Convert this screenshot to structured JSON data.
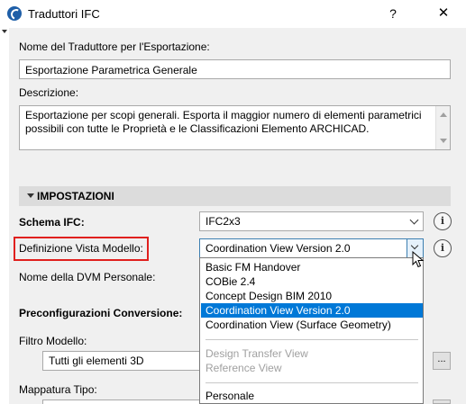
{
  "window": {
    "title": "Traduttori IFC",
    "help_label": "?",
    "close_label": "✕"
  },
  "export_name": {
    "label": "Nome del Traduttore per l'Esportazione:",
    "value": "Esportazione Parametrica Generale"
  },
  "description": {
    "label": "Descrizione:",
    "value": "Esportazione per scopi generali. Esporta il maggior numero di elementi parametrici possibili con tutte le Proprietà e le Classificazioni Elemento ARCHICAD."
  },
  "settings": {
    "header": "IMPOSTAZIONI",
    "schema_label": "Schema IFC:",
    "schema_value": "IFC2x3",
    "mvd_label": "Definizione Vista Modello:",
    "mvd_value": "Coordination View Version 2.0",
    "custom_mvd_label": "Nome della DVM Personale:",
    "preconfig_label": "Preconfigurazioni Conversione:",
    "filter_label": "Filtro Modello:",
    "filter_value": "Tutti gli elementi 3D",
    "type_mapping_label": "Mappatura Tipo:",
    "info_icon_label": "i",
    "more_button_label": "..."
  },
  "mvd_options": [
    {
      "label": "Basic FM Handover",
      "state": "normal"
    },
    {
      "label": "COBie 2.4",
      "state": "normal"
    },
    {
      "label": "Concept Design BIM 2010",
      "state": "normal"
    },
    {
      "label": "Coordination View Version 2.0",
      "state": "selected"
    },
    {
      "label": "Coordination View (Surface Geometry)",
      "state": "normal"
    },
    {
      "label": "Design Transfer View",
      "state": "disabled"
    },
    {
      "label": "Reference View",
      "state": "disabled"
    },
    {
      "label": "Personale",
      "state": "normal"
    }
  ],
  "colors": {
    "highlight": "#0078d7",
    "callout_border": "#e0201e",
    "panel_background": "#f0f0f0"
  }
}
